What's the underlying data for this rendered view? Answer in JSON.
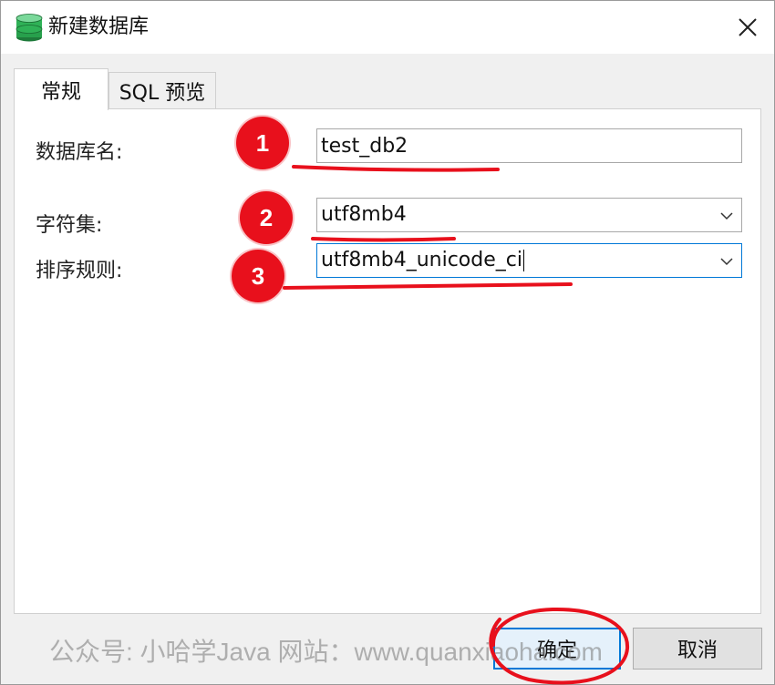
{
  "window": {
    "title": "新建数据库",
    "title_icon": "database-icon",
    "close_icon": "close-icon"
  },
  "tabs": [
    {
      "label": "常规",
      "active": true
    },
    {
      "label": "SQL 预览",
      "active": false
    }
  ],
  "form": {
    "db_name_label": "数据库名:",
    "db_name_value": "test_db2",
    "charset_label": "字符集:",
    "charset_value": "utf8mb4",
    "collation_label": "排序规则:",
    "collation_value": "utf8mb4_unicode_ci"
  },
  "buttons": {
    "ok_label": "确定",
    "cancel_label": "取消"
  },
  "annotations": {
    "badges": [
      "1",
      "2",
      "3"
    ],
    "color": "#e8101c"
  },
  "watermark": {
    "text": "公众号: 小哈学Java  网站：www.quanxiaoha.com"
  }
}
